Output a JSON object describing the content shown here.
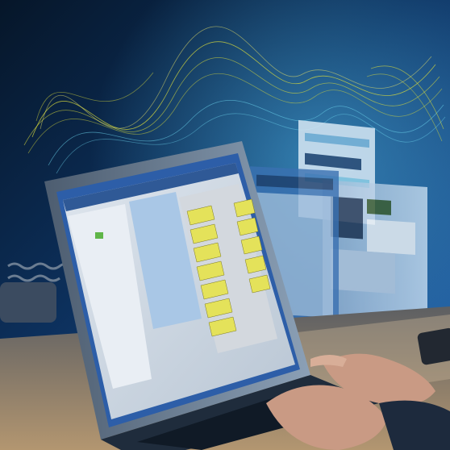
{
  "colors": {
    "accent_bar": "#f2d51c",
    "background_dark": "#071a30",
    "background_mid": "#1d4f8c",
    "wave_yellow": "#d9dc3c",
    "wave_cyan": "#6fd8f0",
    "laptop_body": "#7c8fa5",
    "screen_blue": "#2d5ea8",
    "panel_grey": "#c7ccd3",
    "panel_lightblue": "#a9c7e6",
    "rack_yellow": "#e4e25a",
    "rack_green": "#5fb548",
    "desk_wood": "#a08561",
    "hand_skin": "#c99a84"
  },
  "scene": {
    "elements": [
      "laptop",
      "floating-software-windows",
      "data-waves",
      "desk",
      "hands-typing",
      "telephone-cord",
      "smartphone"
    ]
  }
}
